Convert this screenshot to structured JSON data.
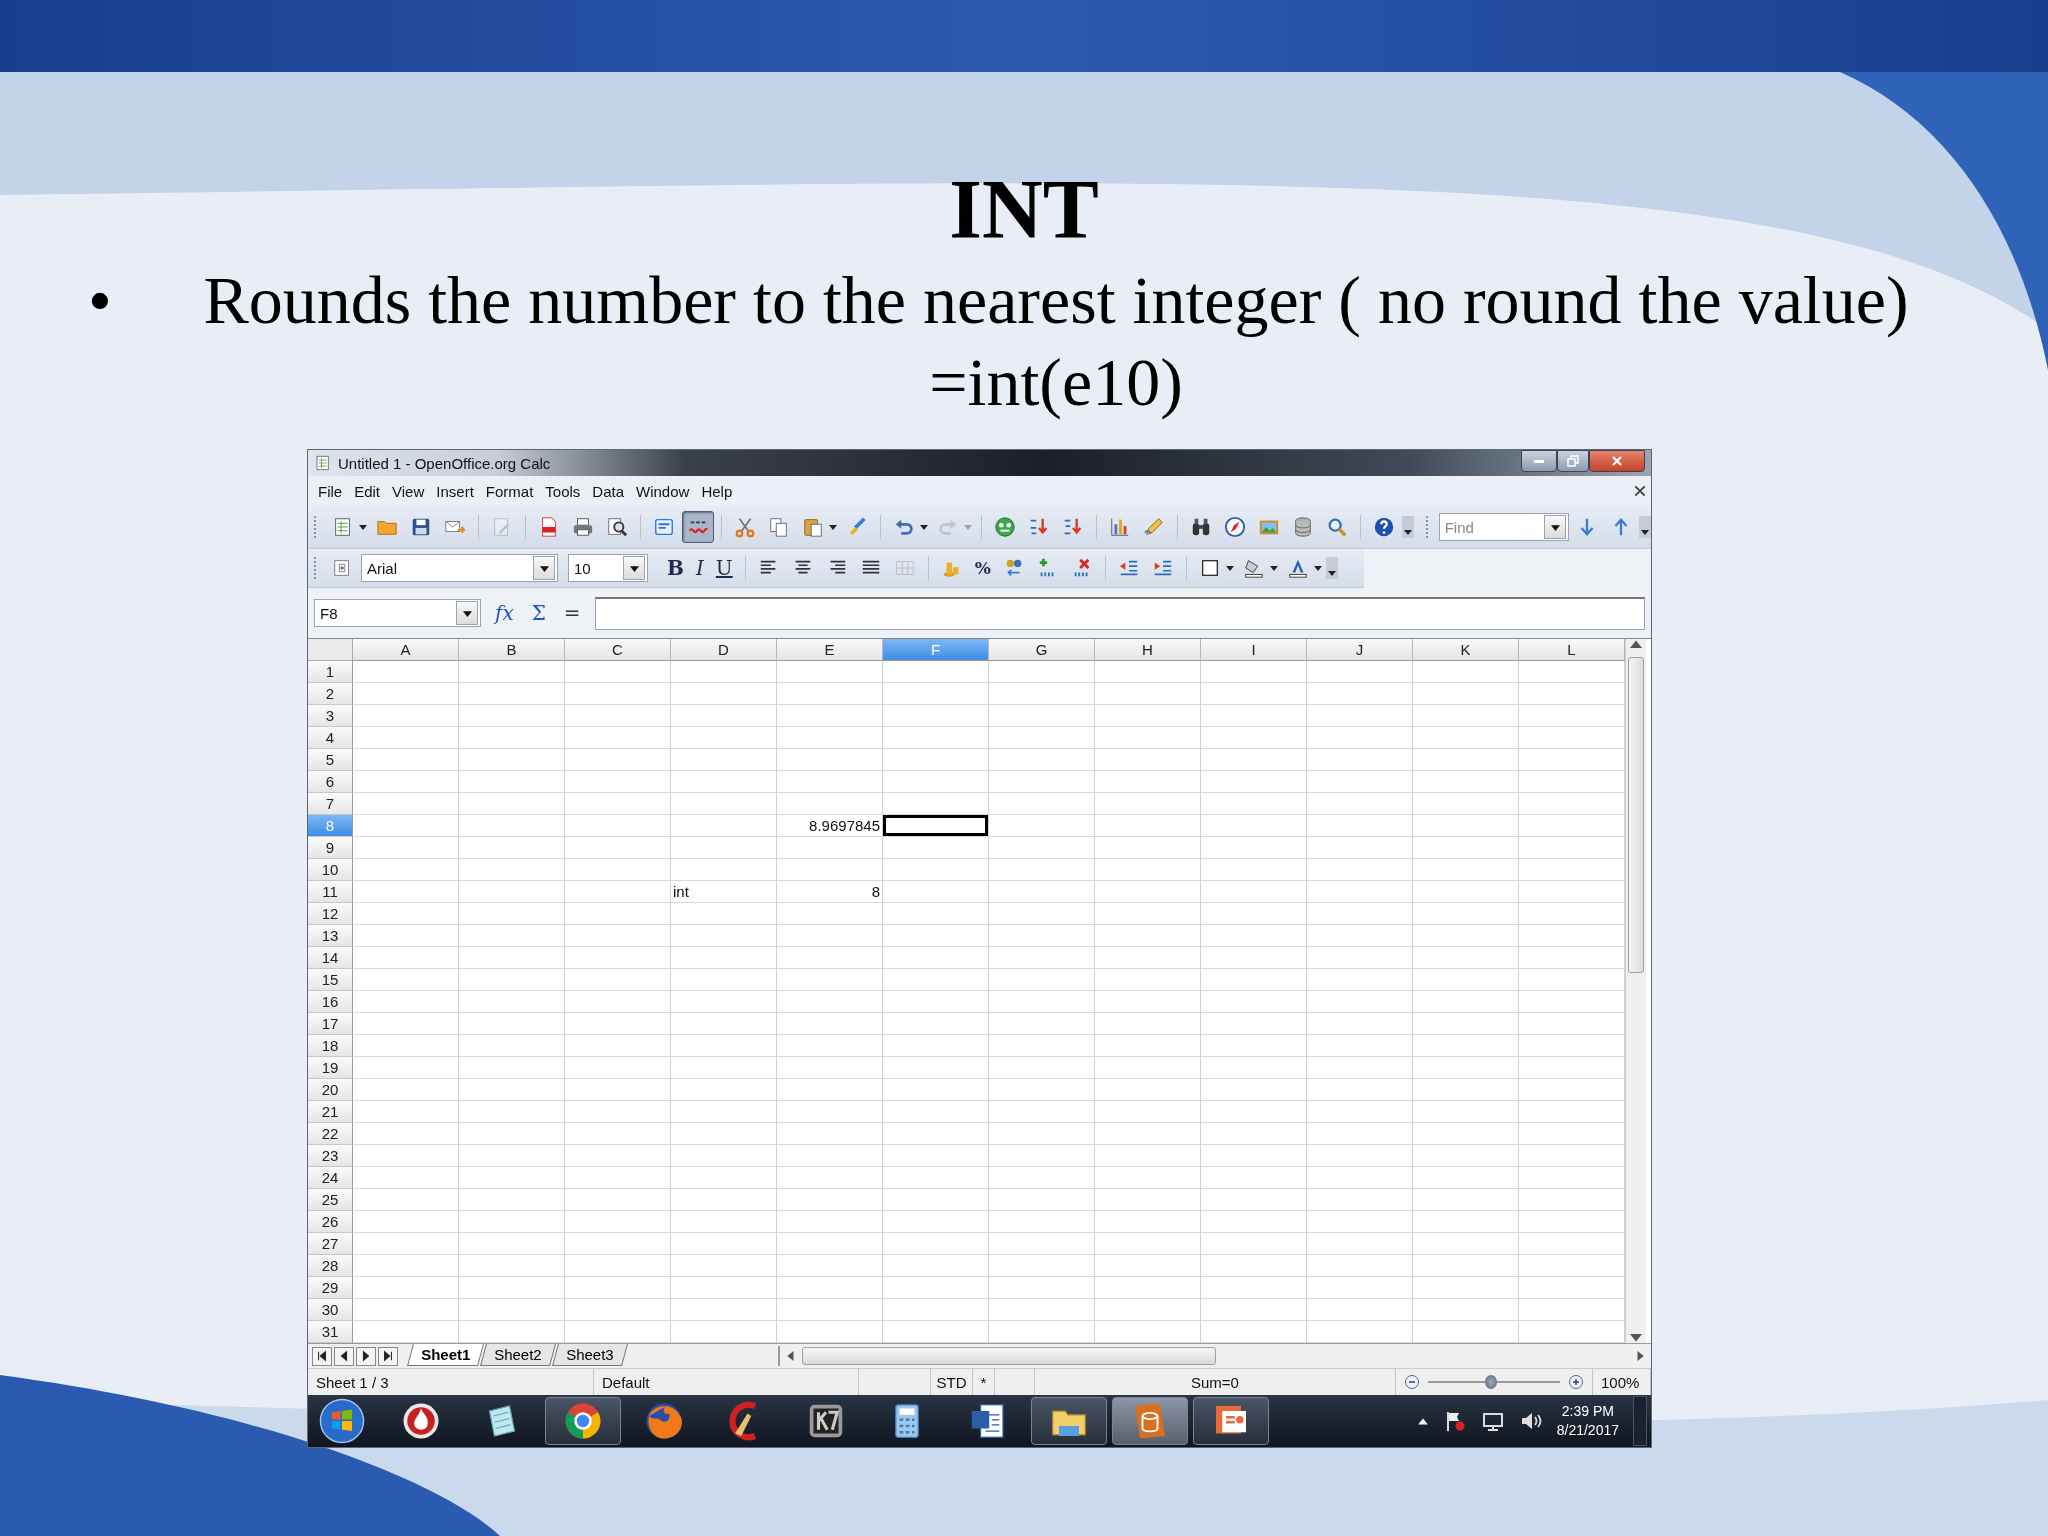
{
  "slide": {
    "title": "INT",
    "bullet": "•",
    "text": "Rounds the number to the nearest integer ( no round the value)",
    "formula": "=int(e10)"
  },
  "window": {
    "title": "Untitled 1 - OpenOffice.org Calc"
  },
  "menu": [
    "File",
    "Edit",
    "View",
    "Insert",
    "Format",
    "Tools",
    "Data",
    "Window",
    "Help"
  ],
  "standard_toolbar": {
    "groups": [
      [
        {
          "kind": "new",
          "disabled": false
        },
        {
          "kind": "dropdown",
          "disabled": false
        },
        {
          "kind": "open",
          "disabled": false
        },
        {
          "kind": "save",
          "disabled": false
        },
        {
          "kind": "mail",
          "disabled": false
        }
      ],
      [
        {
          "kind": "edit",
          "disabled": true
        }
      ],
      [
        {
          "kind": "pdf",
          "disabled": false
        },
        {
          "kind": "print",
          "disabled": false
        },
        {
          "kind": "preview",
          "disabled": false
        }
      ],
      [
        {
          "kind": "spell",
          "disabled": false
        },
        {
          "kind": "autospell",
          "disabled": false,
          "on": true
        }
      ],
      [
        {
          "kind": "cut",
          "disabled": false
        },
        {
          "kind": "copy",
          "disabled": false
        },
        {
          "kind": "paste",
          "disabled": false
        },
        {
          "kind": "dropdown",
          "disabled": false
        },
        {
          "kind": "brush",
          "disabled": false
        }
      ],
      [
        {
          "kind": "undo",
          "disabled": false
        },
        {
          "kind": "dropdown",
          "disabled": false
        },
        {
          "kind": "redo",
          "disabled": true
        },
        {
          "kind": "dropdown",
          "disabled": true
        }
      ],
      [
        {
          "kind": "navigator",
          "disabled": false
        },
        {
          "kind": "sortasc",
          "disabled": false
        },
        {
          "kind": "sortdesc",
          "disabled": false
        }
      ],
      [
        {
          "kind": "chart",
          "disabled": false
        },
        {
          "kind": "draw",
          "disabled": false
        }
      ],
      [
        {
          "kind": "find",
          "disabled": false
        },
        {
          "kind": "compass",
          "disabled": false
        },
        {
          "kind": "gallery",
          "disabled": false
        },
        {
          "kind": "database",
          "disabled": false
        },
        {
          "kind": "zoom",
          "disabled": false
        }
      ],
      [
        {
          "kind": "help",
          "disabled": false
        }
      ]
    ]
  },
  "find_toolbar": {
    "placeholder": "Find"
  },
  "formatting_toolbar": {
    "font": "Arial",
    "size": "10",
    "groups": [
      [
        {
          "kind": "bold",
          "label": "B",
          "disabled": false
        },
        {
          "kind": "italic",
          "label": "I",
          "disabled": false
        },
        {
          "kind": "underline",
          "label": "U",
          "disabled": false
        }
      ],
      [
        {
          "kind": "left",
          "disabled": false
        },
        {
          "kind": "center",
          "disabled": false
        },
        {
          "kind": "right",
          "disabled": false
        },
        {
          "kind": "justify",
          "disabled": false
        },
        {
          "kind": "merge",
          "disabled": true
        }
      ],
      [
        {
          "kind": "currency",
          "disabled": false
        },
        {
          "kind": "percent",
          "label": "%",
          "disabled": false
        },
        {
          "kind": "numformat",
          "disabled": false
        },
        {
          "kind": "adddec",
          "disabled": false
        },
        {
          "kind": "deldec",
          "disabled": false
        }
      ],
      [
        {
          "kind": "decindent",
          "disabled": false
        },
        {
          "kind": "incindent",
          "disabled": false
        }
      ],
      [
        {
          "kind": "borders",
          "disabled": false
        },
        {
          "kind": "dropdown",
          "disabled": false
        },
        {
          "kind": "background",
          "disabled": false
        },
        {
          "kind": "dropdown",
          "disabled": false
        },
        {
          "kind": "fontcolor",
          "disabled": false
        },
        {
          "kind": "dropdown",
          "disabled": false
        }
      ]
    ]
  },
  "formula_bar": {
    "name_box": "F8",
    "buttons": [
      "fx",
      "Σ",
      "="
    ]
  },
  "columns": [
    {
      "label": "A",
      "selected": false
    },
    {
      "label": "B",
      "selected": false
    },
    {
      "label": "C",
      "selected": false
    },
    {
      "label": "D",
      "selected": false
    },
    {
      "label": "E",
      "selected": false
    },
    {
      "label": "F",
      "selected": true
    },
    {
      "label": "G",
      "selected": false
    },
    {
      "label": "H",
      "selected": false
    },
    {
      "label": "I",
      "selected": false
    },
    {
      "label": "J",
      "selected": false
    },
    {
      "label": "K",
      "selected": false
    },
    {
      "label": "L",
      "selected": false
    }
  ],
  "rows": [
    {
      "label": "1",
      "selected": false
    },
    {
      "label": "2",
      "selected": false
    },
    {
      "label": "3",
      "selected": false
    },
    {
      "label": "4",
      "selected": false
    },
    {
      "label": "5",
      "selected": false
    },
    {
      "label": "6",
      "selected": false
    },
    {
      "label": "7",
      "selected": false
    },
    {
      "label": "8",
      "selected": true,
      "cells": [
        {
          "kind": "empty"
        },
        {
          "kind": "empty"
        },
        {
          "kind": "empty"
        },
        {
          "kind": "empty"
        },
        {
          "kind": "number",
          "text": "8.9697845"
        },
        {
          "kind": "empty"
        },
        {
          "kind": "empty"
        },
        {
          "kind": "empty"
        },
        {
          "kind": "empty"
        },
        {
          "kind": "empty"
        },
        {
          "kind": "empty"
        },
        {
          "kind": "empty"
        }
      ]
    },
    {
      "label": "9",
      "selected": false
    },
    {
      "label": "10",
      "selected": false
    },
    {
      "label": "11",
      "selected": false,
      "cells": [
        {
          "kind": "empty"
        },
        {
          "kind": "empty"
        },
        {
          "kind": "empty"
        },
        {
          "kind": "text",
          "text": "int"
        },
        {
          "kind": "number",
          "text": "8"
        },
        {
          "kind": "empty"
        },
        {
          "kind": "empty"
        },
        {
          "kind": "empty"
        },
        {
          "kind": "empty"
        },
        {
          "kind": "empty"
        },
        {
          "kind": "empty"
        },
        {
          "kind": "empty"
        }
      ]
    },
    {
      "label": "12",
      "selected": false
    },
    {
      "label": "13",
      "selected": false
    },
    {
      "label": "14",
      "selected": false
    },
    {
      "label": "15",
      "selected": false
    },
    {
      "label": "16",
      "selected": false
    },
    {
      "label": "17",
      "selected": false
    },
    {
      "label": "18",
      "selected": false
    },
    {
      "label": "19",
      "selected": false
    },
    {
      "label": "20",
      "selected": false
    },
    {
      "label": "21",
      "selected": false
    },
    {
      "label": "22",
      "selected": false
    },
    {
      "label": "23",
      "selected": false
    },
    {
      "label": "24",
      "selected": false
    },
    {
      "label": "25",
      "selected": false
    },
    {
      "label": "26",
      "selected": false
    },
    {
      "label": "27",
      "selected": false
    },
    {
      "label": "28",
      "selected": false
    },
    {
      "label": "29",
      "selected": false
    },
    {
      "label": "30",
      "selected": false
    },
    {
      "label": "31",
      "selected": false
    }
  ],
  "sheet_tabs": [
    {
      "label": "Sheet1",
      "selected": true
    },
    {
      "label": "Sheet2",
      "selected": false
    },
    {
      "label": "Sheet3",
      "selected": false
    }
  ],
  "status_bar": {
    "sheet": "Sheet 1 / 3",
    "style": "Default",
    "mode": "STD",
    "modified": "*",
    "sum": "Sum=0",
    "zoom": {
      "level": 0.48,
      "text": "100%"
    }
  },
  "taskbar": {
    "apps": [
      {
        "kind": "flame",
        "running": false,
        "selected": false
      },
      {
        "kind": "notepad",
        "running": false,
        "selected": false
      },
      {
        "kind": "rings",
        "running": true,
        "selected": false
      },
      {
        "kind": "fox",
        "running": false,
        "selected": false
      },
      {
        "kind": "broom",
        "running": false,
        "selected": false
      },
      {
        "kind": "tile",
        "running": false,
        "selected": false
      },
      {
        "kind": "calculator",
        "running": false,
        "selected": false
      },
      {
        "kind": "document",
        "running": false,
        "selected": false
      },
      {
        "kind": "folder",
        "running": true,
        "selected": false
      },
      {
        "kind": "database",
        "running": true,
        "selected": true
      },
      {
        "kind": "slides",
        "running": true,
        "selected": false
      }
    ],
    "time": "2:39 PM",
    "date": "8/21/2017"
  }
}
